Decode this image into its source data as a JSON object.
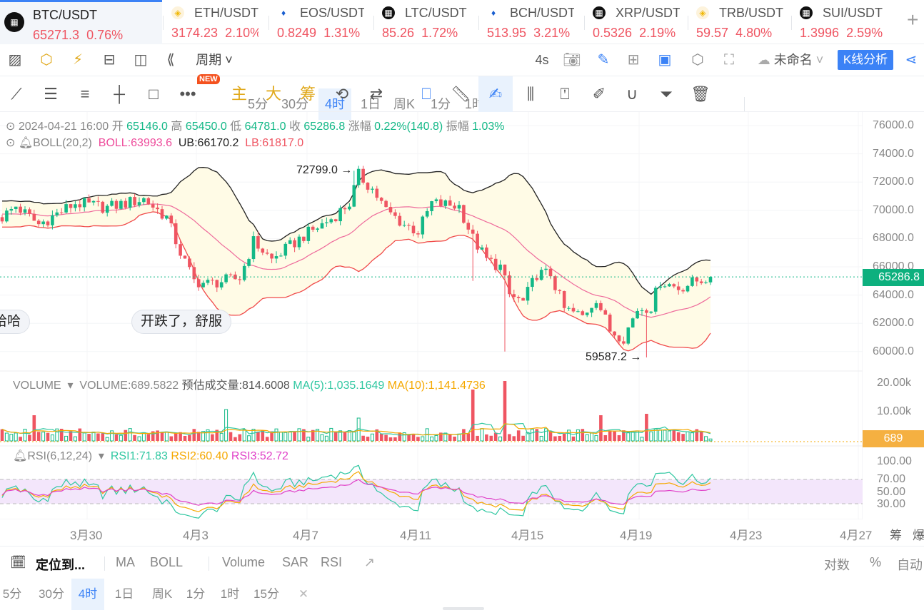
{
  "tabs": [
    {
      "pair": "BTC/USDT",
      "price": "65271.3",
      "change": "0.76%",
      "icon": "okx-logo-icon",
      "active": true
    },
    {
      "pair": "ETH/USDT",
      "price": "3174.23",
      "change": "2.10%",
      "icon": "binance-logo-icon"
    },
    {
      "pair": "EOS/USDT",
      "price": "0.8249",
      "change": "1.31%",
      "icon": "huobi-logo-icon"
    },
    {
      "pair": "LTC/USDT",
      "price": "85.26",
      "change": "1.72%",
      "icon": "okx-logo-icon"
    },
    {
      "pair": "BCH/USDT",
      "price": "513.95",
      "change": "3.21%",
      "icon": "huobi-logo-icon"
    },
    {
      "pair": "XRP/USDT",
      "price": "0.5326",
      "change": "2.19%",
      "icon": "okx-logo-icon"
    },
    {
      "pair": "TRB/USDT",
      "price": "59.57",
      "change": "4.80%",
      "icon": "binance-logo-icon"
    },
    {
      "pair": "SUI/USDT",
      "price": "1.3996",
      "change": "2.59%",
      "icon": "okx-logo-icon"
    }
  ],
  "toolbar": {
    "period_label": "周期",
    "intervals": [
      "5分",
      "30分",
      "4时",
      "1日",
      "周K",
      "1分",
      "1时"
    ],
    "active_interval": "4时",
    "refresh": "4s",
    "layout_name": "未命名",
    "analysis_button": "K线分析"
  },
  "draw_toolbar": {
    "new_badge": "NEW",
    "main": "主",
    "big": "大",
    "chip": "筹"
  },
  "ohlc": {
    "datetime": "2024-04-21 16:00",
    "open_label": "开",
    "open": "65146.0",
    "high_label": "高",
    "high": "65450.0",
    "low_label": "低",
    "low": "64781.0",
    "close_label": "收",
    "close": "65286.8",
    "change_label": "涨幅",
    "change": "0.22%(140.8)",
    "amp_label": "振幅",
    "amp": "1.03%"
  },
  "boll": {
    "name": "BOLL(20,2)",
    "mid": "BOLL:63993.6",
    "ub": "UB:66170.2",
    "lb": "LB:61817.0"
  },
  "volume": {
    "name": "VOLUME",
    "value": "VOLUME:689.5822",
    "estimate": "预估成交量:814.6008",
    "ma5": "MA(5):1,035.1649",
    "ma10": "MA(10):1,141.4736",
    "current": "689",
    "axis": [
      "20.00k",
      "10.00k"
    ]
  },
  "rsi": {
    "name": "RSI(6,12,24)",
    "rsi1": "RSI1:71.83",
    "rsi2": "RSI2:60.40",
    "rsi3": "RSI3:52.72",
    "axis": [
      "100.00",
      "70.00",
      "50.00",
      "30.00"
    ]
  },
  "price_axis": [
    "76000.0",
    "74000.0",
    "72000.0",
    "70000.0",
    "68000.0",
    "66000.0",
    "64000.0",
    "62000.0",
    "60000.0"
  ],
  "current_price": "65286.8",
  "annotations": {
    "high": "72799.0",
    "low": "59587.2",
    "bubble1": "哈哈",
    "bubble2": "开跌了，舒服"
  },
  "dates": [
    "3月30",
    "4月3",
    "4月7",
    "4月11",
    "4月15",
    "4月19",
    "4月23",
    "4月27"
  ],
  "right_side_labels": [
    "筹",
    "爆"
  ],
  "bottom_bar": {
    "locate": "定位到...",
    "indicators": [
      "MA",
      "BOLL",
      "Volume",
      "SAR",
      "RSI"
    ],
    "log": "对数",
    "percent": "%",
    "auto": "自动"
  },
  "timeframes": [
    "5分",
    "30分",
    "4时",
    "1日",
    "周K",
    "1分",
    "1时",
    "15分"
  ],
  "colors": {
    "up": "#13b887",
    "down": "#ef5562",
    "accent": "#3b82f6",
    "boll_mid": "#ee6a9b",
    "boll_band": "#222222",
    "boll_lb": "#f04a4a",
    "ma5": "#2fc7a1",
    "ma10": "#f5a800"
  },
  "chart_data": {
    "type": "candlestick",
    "symbol": "BTC/USDT",
    "interval": "4h",
    "ylim": [
      59000,
      76500
    ],
    "close_anchors": [
      [
        0,
        69500
      ],
      [
        3,
        70300
      ],
      [
        8,
        69000
      ],
      [
        16,
        70500
      ],
      [
        23,
        70200
      ],
      [
        31,
        70800
      ],
      [
        36,
        69500
      ],
      [
        39,
        67000
      ],
      [
        42,
        65000
      ],
      [
        45,
        64800
      ],
      [
        52,
        65200
      ],
      [
        55,
        67800
      ],
      [
        59,
        66500
      ],
      [
        66,
        68200
      ],
      [
        72,
        69400
      ],
      [
        76,
        70500
      ],
      [
        78,
        72500
      ],
      [
        81,
        71500
      ],
      [
        84,
        70000
      ],
      [
        88,
        69000
      ],
      [
        91,
        68500
      ],
      [
        94,
        70500
      ],
      [
        100,
        70300
      ],
      [
        103,
        68000
      ],
      [
        106,
        66500
      ],
      [
        109,
        66000
      ],
      [
        111,
        64000
      ],
      [
        114,
        63500
      ],
      [
        117,
        65500
      ],
      [
        120,
        65500
      ],
      [
        123,
        63000
      ],
      [
        127,
        62500
      ],
      [
        130,
        63800
      ],
      [
        133,
        61500
      ],
      [
        136,
        61000
      ],
      [
        139,
        63000
      ],
      [
        142,
        63200
      ],
      [
        144,
        65000
      ],
      [
        148,
        64500
      ],
      [
        152,
        65000
      ],
      [
        155,
        65286.8
      ]
    ],
    "extreme_high": {
      "index": 77,
      "value": 72799.0
    },
    "extreme_low": {
      "index": 141,
      "value": 59587.2
    },
    "long_wicks": [
      [
        103,
        65000
      ],
      [
        110,
        60000
      ]
    ],
    "volume_spikes": [
      [
        7,
        9000
      ],
      [
        49,
        11000
      ],
      [
        103,
        18000
      ],
      [
        110,
        21000
      ],
      [
        78,
        8000
      ],
      [
        131,
        9000
      ],
      [
        141,
        9500
      ]
    ],
    "rsi_band": [
      30,
      70
    ]
  }
}
